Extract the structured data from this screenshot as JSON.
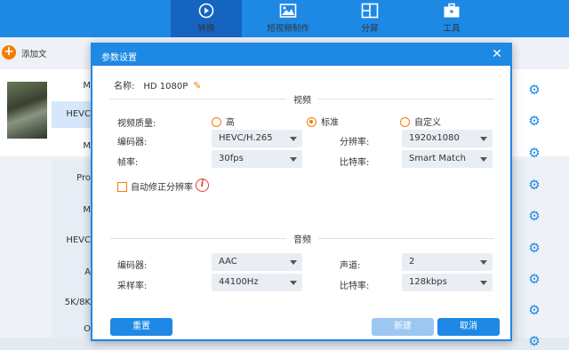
{
  "nav": {
    "items": [
      {
        "label": "转换",
        "icon": "convert-icon"
      },
      {
        "label": "短视频制作",
        "icon": "image-icon"
      },
      {
        "label": "分屏",
        "icon": "split-screen-icon"
      },
      {
        "label": "工具",
        "icon": "toolbox-icon"
      }
    ]
  },
  "background": {
    "add_file": "添加文",
    "formats": [
      "M",
      "HEVC",
      "M",
      "Pro",
      "M",
      "HEVC",
      "A",
      "",
      "5K/8K",
      "O"
    ]
  },
  "dialog": {
    "title": "参数设置",
    "name_label": "名称:",
    "name_value": "HD 1080P",
    "video_section": "视频",
    "audio_section": "音频",
    "quality_label": "视频质量:",
    "quality_options": [
      {
        "label": "高",
        "selected": false
      },
      {
        "label": "标准",
        "selected": true
      },
      {
        "label": "自定义",
        "selected": false
      }
    ],
    "video": {
      "encoder_label": "编码器:",
      "encoder_value": "HEVC/H.265",
      "framerate_label": "帧率:",
      "framerate_value": "30fps",
      "resolution_label": "分辨率:",
      "resolution_value": "1920x1080",
      "bitrate_label": "比特率:",
      "bitrate_value": "Smart Match"
    },
    "auto_fix_label": "自动修正分辨率",
    "audio": {
      "encoder_label": "编码器:",
      "encoder_value": "AAC",
      "samplerate_label": "采样率:",
      "samplerate_value": "44100Hz",
      "channel_label": "声道:",
      "channel_value": "2",
      "bitrate_label": "比特率:",
      "bitrate_value": "128kbps"
    },
    "reset_button": "重置",
    "new_button": "新建",
    "cancel_button": "取消"
  },
  "colors": {
    "primary": "#1e88e5",
    "accent": "#f57c00",
    "info": "#e53935"
  }
}
